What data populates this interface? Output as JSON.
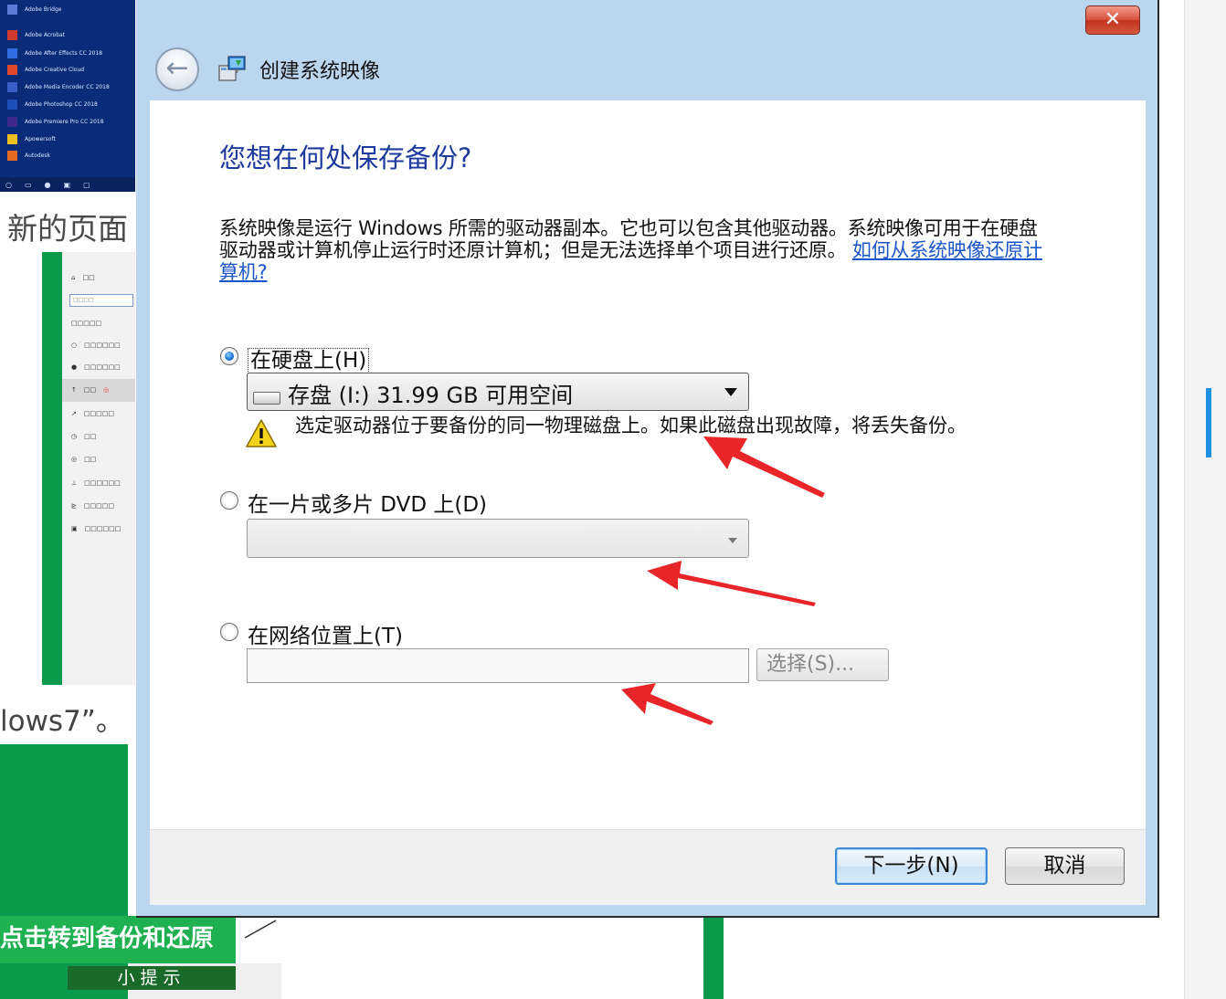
{
  "dialog": {
    "title": "创建系统映像",
    "close_label": "✕",
    "back_label": "←",
    "heading": "您想在何处保存备份?",
    "description": "系统映像是运行 Windows 所需的驱动器副本。它也可以包含其他驱动器。系统映像可用于在硬盘驱动器或计算机停止运行时还原计算机；但是无法选择单个项目进行还原。",
    "help_link": "如何从系统映像还原计算机?",
    "options": {
      "hard_disk": {
        "label": "在硬盘上(H)",
        "checked": true,
        "selected_drive": "存盘 (I:)  31.99 GB 可用空间"
      },
      "warning": "选定驱动器位于要备份的同一物理磁盘上。如果此磁盘出现故障，将丢失备份。",
      "dvd": {
        "label": "在一片或多片 DVD 上(D)",
        "checked": false,
        "selected_value": ""
      },
      "network": {
        "label": "在网络位置上(T)",
        "checked": false,
        "value": "",
        "select_button": "选择(S)..."
      }
    },
    "buttons": {
      "next": "下一步(N)",
      "cancel": "取消"
    }
  },
  "background": {
    "heading_fragment": "新的页面",
    "caption_fragment": "lows7”。",
    "green_banner": "点击转到备份和还原",
    "tip_label": "小提示"
  },
  "colors": {
    "window_frame": "#bcd6ef",
    "heading_blue": "#1e3a9e",
    "link_blue": "#1a56c8",
    "annotation_red": "#e8262a",
    "article_green": "#0b9a4c"
  },
  "icons": [
    "back-arrow-icon",
    "system-image-icon",
    "drive-icon",
    "dropdown-arrow-icon",
    "warning-icon",
    "close-icon"
  ]
}
